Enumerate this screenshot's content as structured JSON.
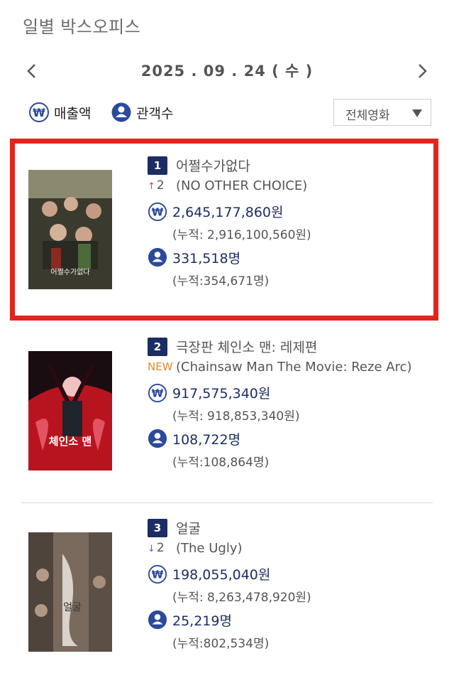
{
  "page": {
    "title": "일별 박스오피스"
  },
  "date": {
    "text": "2025 . 09 . 24 ( 수 )"
  },
  "filters": {
    "sales_label": "매출액",
    "audience_label": "관객수",
    "movie_select": "전체영화"
  },
  "colors": {
    "accent_navy": "#1c2d64",
    "highlight_red": "#e3241c",
    "rank_up": "#e0413b",
    "rank_down": "#3c6fc2",
    "new_badge": "#e48a2a"
  },
  "movies": [
    {
      "rank": "1",
      "title": "어쩔수가없다",
      "change_type": "up",
      "change_arrow": "↑",
      "change_value": "2",
      "english_title": "(NO OTHER CHOICE)",
      "sales": "2,645,177,860원",
      "cumulative_sales": "(누적: 2,916,100,560원)",
      "audience": "331,518명",
      "cumulative_audience": "(누적:354,671명)",
      "poster_text": "어쩔수가없다"
    },
    {
      "rank": "2",
      "title": "극장판 체인소 맨: 레제편",
      "change_type": "new",
      "change_label": "NEW",
      "english_title": "(Chainsaw Man The Movie: Reze Arc)",
      "sales": "917,575,340원",
      "cumulative_sales": "(누적: 918,853,340원)",
      "audience": "108,722명",
      "cumulative_audience": "(누적:108,864명)",
      "poster_text": "체인소 맨"
    },
    {
      "rank": "3",
      "title": "얼굴",
      "change_type": "down",
      "change_arrow": "↓",
      "change_value": "2",
      "english_title": "(The Ugly)",
      "sales": "198,055,040원",
      "cumulative_sales": "(누적: 8,263,478,920원)",
      "audience": "25,219명",
      "cumulative_audience": "(누적:802,534명)",
      "poster_text": "얼굴"
    }
  ],
  "icons": {
    "prev": "chevron-left-icon",
    "next": "chevron-right-icon",
    "won": "won-icon",
    "person": "person-icon",
    "dropdown": "triangle-down-icon"
  }
}
